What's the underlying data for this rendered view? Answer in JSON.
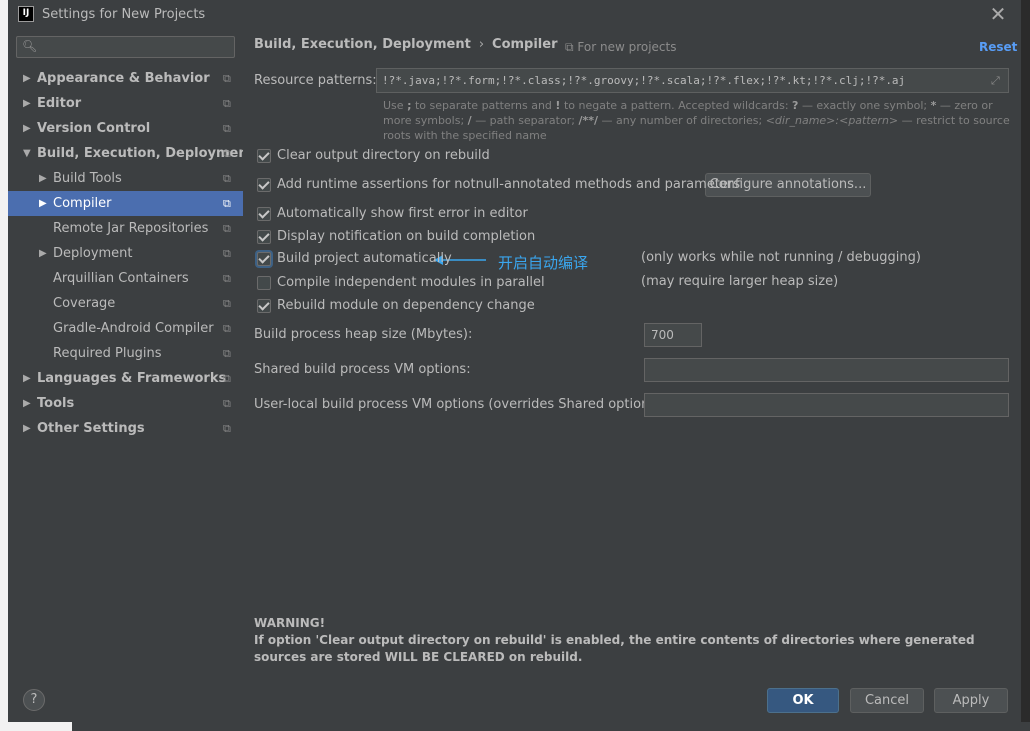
{
  "window": {
    "title": "Settings for New Projects",
    "close_glyph": "✕"
  },
  "search": {
    "placeholder": "",
    "icon": "search-icon"
  },
  "sidebar": {
    "items": [
      {
        "label": "Appearance & Behavior",
        "level": 0,
        "expanded": false,
        "bold": true
      },
      {
        "label": "Editor",
        "level": 0,
        "expanded": false,
        "bold": true
      },
      {
        "label": "Version Control",
        "level": 0,
        "expanded": false,
        "bold": true
      },
      {
        "label": "Build, Execution, Deployment",
        "level": 0,
        "expanded": true,
        "bold": true
      },
      {
        "label": "Build Tools",
        "level": 1,
        "expanded": false,
        "bold": false
      },
      {
        "label": "Compiler",
        "level": 1,
        "expanded": false,
        "bold": false,
        "selected": true
      },
      {
        "label": "Remote Jar Repositories",
        "level": 1,
        "bold": false
      },
      {
        "label": "Deployment",
        "level": 1,
        "expanded": false,
        "bold": false
      },
      {
        "label": "Arquillian Containers",
        "level": 1,
        "bold": false
      },
      {
        "label": "Coverage",
        "level": 1,
        "bold": false
      },
      {
        "label": "Gradle-Android Compiler",
        "level": 1,
        "bold": false
      },
      {
        "label": "Required Plugins",
        "level": 1,
        "bold": false
      },
      {
        "label": "Languages & Frameworks",
        "level": 0,
        "expanded": false,
        "bold": true
      },
      {
        "label": "Tools",
        "level": 0,
        "expanded": false,
        "bold": true
      },
      {
        "label": "Other Settings",
        "level": 0,
        "expanded": false,
        "bold": true
      }
    ]
  },
  "header": {
    "crumb_parent": "Build, Execution, Deployment",
    "crumb_current": "Compiler",
    "scope": "For new projects",
    "reset": "Reset"
  },
  "resource_patterns": {
    "label": "Resource patterns:",
    "value": "!?*.java;!?*.form;!?*.class;!?*.groovy;!?*.scala;!?*.flex;!?*.kt;!?*.clj;!?*.aj",
    "help": {
      "p1": "Use",
      "k1": ";",
      "p2": "to separate patterns and",
      "k2": "!",
      "p3": "to negate a pattern. Accepted wildcards:",
      "k3": "?",
      "p4": "— exactly one symbol;",
      "k4": "*",
      "p5": "— zero or more symbols;",
      "k5": "/",
      "p6": "— path separator;",
      "k6": "/**/",
      "p7": "— any number of directories;",
      "k7": "<dir_name>:<pattern>",
      "p8": "— restrict to source roots with the specified name"
    }
  },
  "options": [
    {
      "label": "Clear output directory on rebuild",
      "checked": true
    },
    {
      "label": "Add runtime assertions for notnull-annotated methods and parameters",
      "checked": true
    },
    {
      "label": "Automatically show first error in editor",
      "checked": true
    },
    {
      "label": "Display notification on build completion",
      "checked": true
    },
    {
      "label": "Build project automatically",
      "checked": true,
      "note": "(only works while not running / debugging)"
    },
    {
      "label": "Compile independent modules in parallel",
      "checked": false,
      "note": "(may require larger heap size)"
    },
    {
      "label": "Rebuild module on dependency change",
      "checked": true
    }
  ],
  "configure_button": "Configure annotations...",
  "annotation": {
    "text": "开启自动编译",
    "color": "#3aa6ee"
  },
  "fields": {
    "heap_label": "Build process heap size (Mbytes):",
    "heap_value": "700",
    "shared_vm_label": "Shared build process VM options:",
    "shared_vm_value": "",
    "user_vm_label": "User-local build process VM options (overrides Shared options):",
    "user_vm_value": ""
  },
  "warning": {
    "title": "WARNING!",
    "body": "If option 'Clear output directory on rebuild' is enabled, the entire contents of directories where generated sources are stored WILL BE CLEARED on rebuild."
  },
  "footer": {
    "help": "?",
    "ok": "OK",
    "cancel": "Cancel",
    "apply": "Apply"
  },
  "colors": {
    "background": "#3c3f41",
    "selection": "#4b6eaf",
    "link": "#589df6",
    "default_button": "#365880"
  }
}
